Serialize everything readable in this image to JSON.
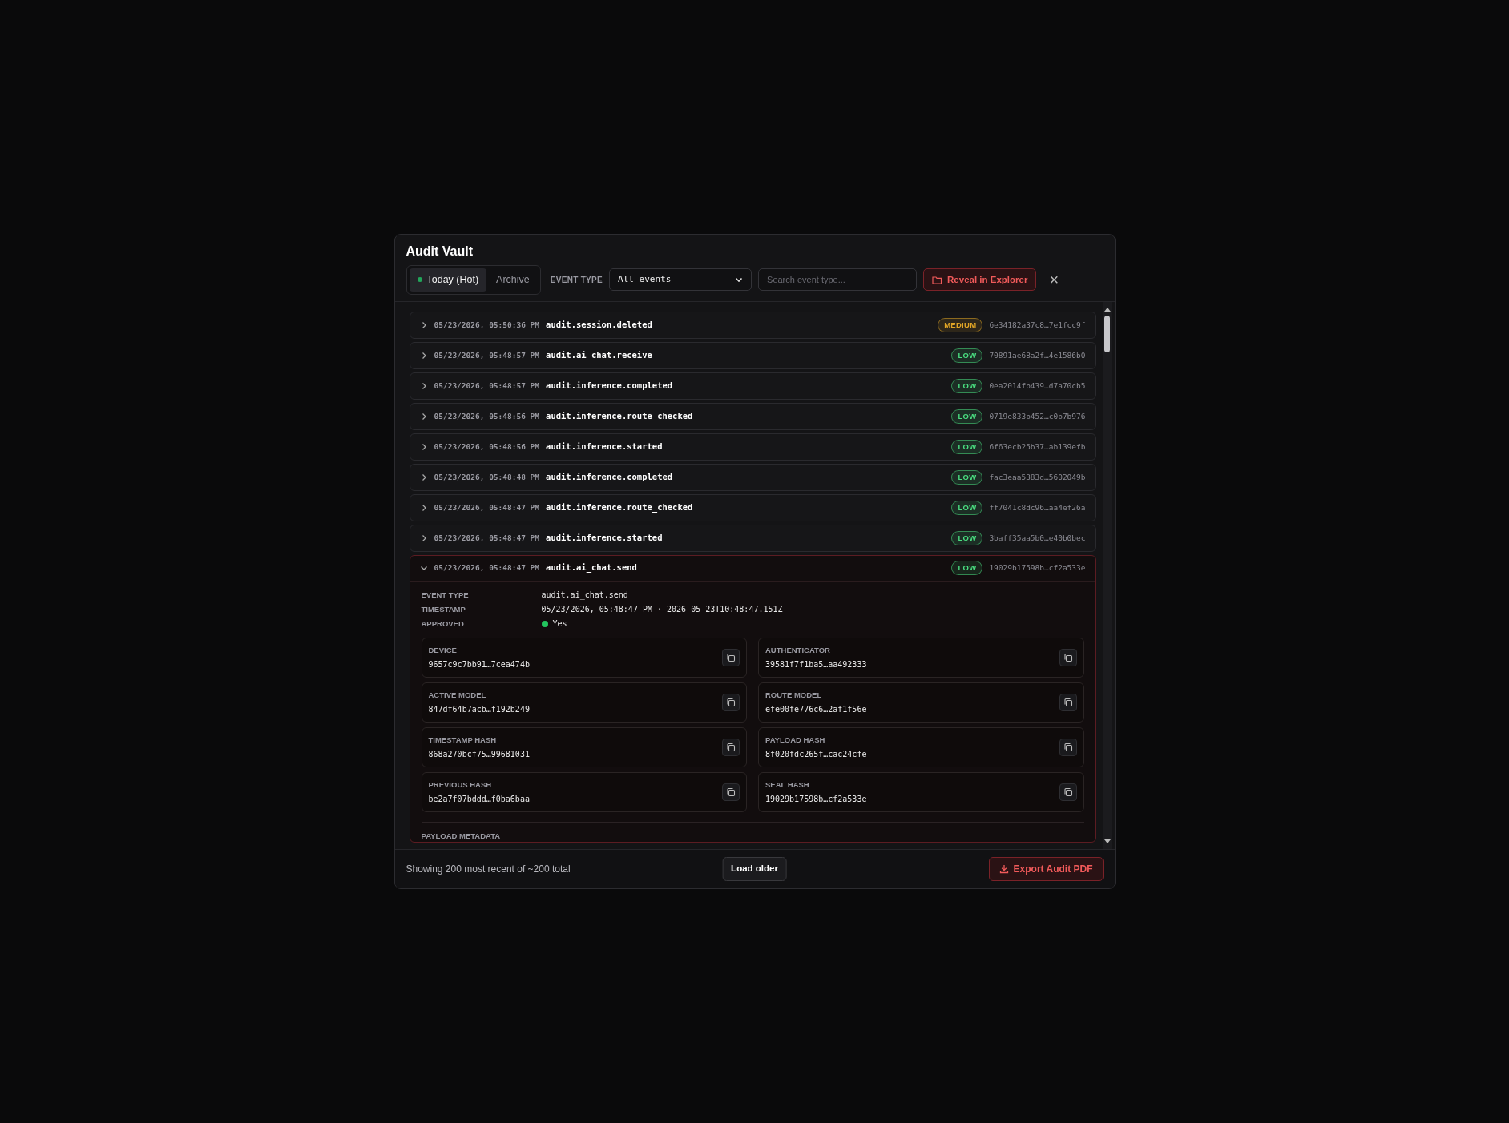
{
  "dialog": {
    "title": "Audit Vault"
  },
  "toolbar": {
    "tabs": [
      {
        "label": "Today (Hot)",
        "selected": true,
        "live": true
      },
      {
        "label": "Archive",
        "selected": false,
        "live": false
      }
    ],
    "filter_label": "EVENT TYPE",
    "filter_value": "All events",
    "search": {
      "placeholder": "Search event type..."
    },
    "reveal_button": "Reveal in Explorer",
    "close": "×"
  },
  "events": [
    {
      "timestamp": "05/23/2026, 05:50:36 PM",
      "type": "audit.session.deleted",
      "severity": "MEDIUM",
      "color": "#e0a526",
      "hash": "6e34182a37c8…7e1fcc9f",
      "expanded": false
    },
    {
      "timestamp": "05/23/2026, 05:48:57 PM",
      "type": "audit.ai_chat.receive",
      "severity": "LOW",
      "color": "#4ade80",
      "hash": "70891ae68a2f…4e1586b0",
      "expanded": false
    },
    {
      "timestamp": "05/23/2026, 05:48:57 PM",
      "type": "audit.inference.completed",
      "severity": "LOW",
      "color": "#4ade80",
      "hash": "0ea2014fb439…d7a70cb5",
      "expanded": false
    },
    {
      "timestamp": "05/23/2026, 05:48:56 PM",
      "type": "audit.inference.route_checked",
      "severity": "LOW",
      "color": "#4ade80",
      "hash": "0719e833b452…c0b7b976",
      "expanded": false
    },
    {
      "timestamp": "05/23/2026, 05:48:56 PM",
      "type": "audit.inference.started",
      "severity": "LOW",
      "color": "#4ade80",
      "hash": "6f63ecb25b37…ab139efb",
      "expanded": false
    },
    {
      "timestamp": "05/23/2026, 05:48:48 PM",
      "type": "audit.inference.completed",
      "severity": "LOW",
      "color": "#4ade80",
      "hash": "fac3eaa5383d…5602049b",
      "expanded": false
    },
    {
      "timestamp": "05/23/2026, 05:48:47 PM",
      "type": "audit.inference.route_checked",
      "severity": "LOW",
      "color": "#4ade80",
      "hash": "ff7041c8dc96…aa4ef26a",
      "expanded": false
    },
    {
      "timestamp": "05/23/2026, 05:48:47 PM",
      "type": "audit.inference.started",
      "severity": "LOW",
      "color": "#4ade80",
      "hash": "3baff35aa5b0…e40b0bec",
      "expanded": false
    },
    {
      "timestamp": "05/23/2026, 05:48:47 PM",
      "type": "audit.ai_chat.send",
      "severity": "LOW",
      "color": "#4ade80",
      "hash": "19029b17598b…cf2a533e",
      "expanded": true,
      "details": {
        "fields": [
          {
            "label": "EVENT TYPE",
            "value": "audit.ai_chat.send"
          },
          {
            "label": "TIMESTAMP",
            "value": "05/23/2026, 05:48:47 PM · 2026-05-23T10:48:47.151Z"
          }
        ],
        "approved": {
          "label": "APPROVED",
          "value": "Yes",
          "ok": true
        },
        "hashes": [
          {
            "label": "DEVICE",
            "value": "9657c9c7bb91…7cea474b"
          },
          {
            "label": "AUTHENTICATOR",
            "value": "39581f7f1ba5…aa492333"
          },
          {
            "label": "ACTIVE MODEL",
            "value": "847df64b7acb…f192b249"
          },
          {
            "label": "ROUTE MODEL",
            "value": "efe00fe776c6…2af1f56e"
          },
          {
            "label": "TIMESTAMP HASH",
            "value": "868a270bcf75…99681031"
          },
          {
            "label": "PAYLOAD HASH",
            "value": "8f020fdc265f…cac24cfe"
          },
          {
            "label": "PREVIOUS HASH",
            "value": "be2a7f07bddd…f0ba6baa"
          },
          {
            "label": "SEAL HASH",
            "value": "19029b17598b…cf2a533e"
          }
        ],
        "section": "PAYLOAD METADATA"
      }
    }
  ],
  "footer": {
    "summary": "Showing 200 most recent of ~200 total",
    "load_button": "Load older",
    "export_button": "Export Audit PDF"
  }
}
